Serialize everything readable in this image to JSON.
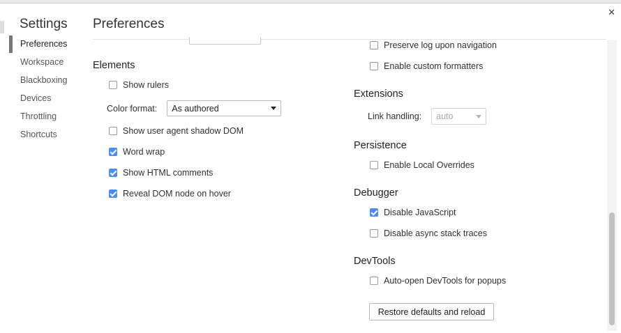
{
  "sidebar": {
    "title": "Settings",
    "items": [
      {
        "label": "Preferences",
        "active": true
      },
      {
        "label": "Workspace"
      },
      {
        "label": "Blackboxing"
      },
      {
        "label": "Devices"
      },
      {
        "label": "Throttling"
      },
      {
        "label": "Shortcuts"
      }
    ]
  },
  "main": {
    "title": "Preferences"
  },
  "elements": {
    "title": "Elements",
    "show_rulers": "Show rulers",
    "color_format_label": "Color format:",
    "color_format_value": "As authored",
    "shadow_dom": "Show user agent shadow DOM",
    "word_wrap": "Word wrap",
    "html_comments": "Show HTML comments",
    "reveal_dom": "Reveal DOM node on hover"
  },
  "console": {
    "preserve_log": "Preserve log upon navigation",
    "custom_formatters": "Enable custom formatters"
  },
  "extensions": {
    "title": "Extensions",
    "link_handling_label": "Link handling:",
    "link_handling_value": "auto"
  },
  "persistence": {
    "title": "Persistence",
    "local_overrides": "Enable Local Overrides"
  },
  "debugger": {
    "title": "Debugger",
    "disable_js": "Disable JavaScript",
    "async_traces": "Disable async stack traces"
  },
  "devtools": {
    "title": "DevTools",
    "auto_open": "Auto-open DevTools for popups",
    "restore_button": "Restore defaults and reload"
  },
  "icons": {
    "close": "close-icon",
    "checkbox": "checkbox",
    "dropdown": "chevron-down-icon"
  },
  "colors": {
    "accent": "#4a8df6",
    "text": "#303030"
  }
}
